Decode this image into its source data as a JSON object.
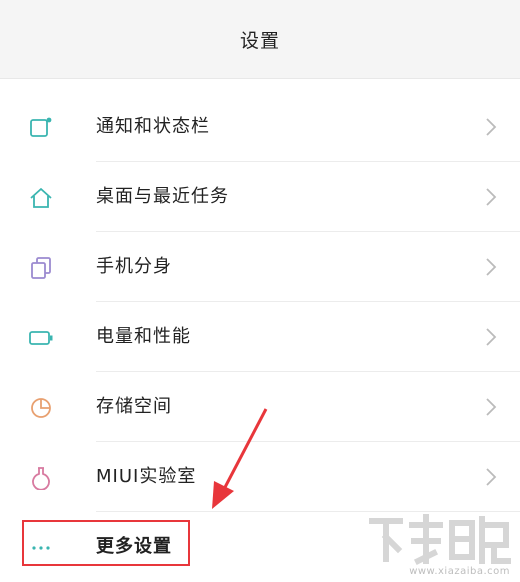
{
  "header": {
    "title": "设置"
  },
  "items": [
    {
      "label": "通知和状态栏",
      "icon": "notification-icon"
    },
    {
      "label": "桌面与最近任务",
      "icon": "home-icon"
    },
    {
      "label": "手机分身",
      "icon": "dual-copy-icon"
    },
    {
      "label": "电量和性能",
      "icon": "battery-icon"
    },
    {
      "label": "存储空间",
      "icon": "storage-pie-icon"
    },
    {
      "label": "MIUI实验室",
      "icon": "flask-icon"
    },
    {
      "label": "更多设置",
      "icon": "more-dots-icon"
    }
  ],
  "colors": {
    "accent": "#3ab5b0",
    "highlight": "#e8363b"
  },
  "watermark": {
    "text": "www.xiazaiba.com"
  }
}
